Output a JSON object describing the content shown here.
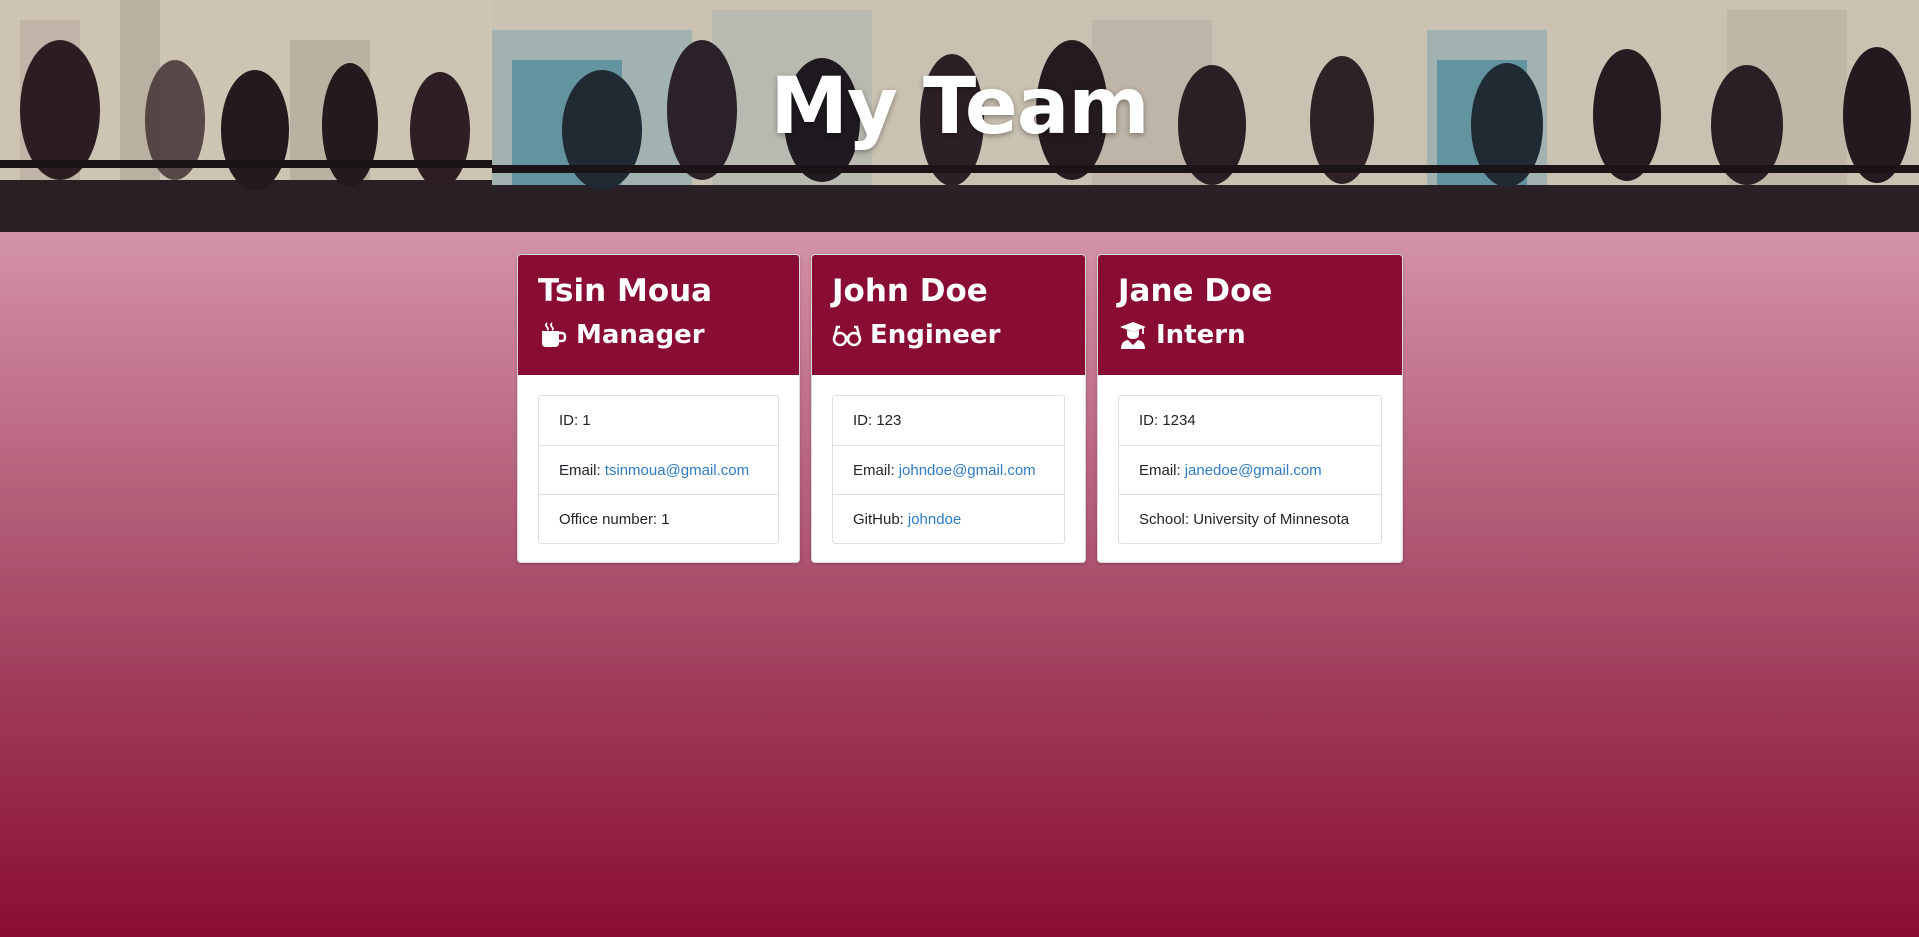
{
  "header": {
    "title": "My Team"
  },
  "team": [
    {
      "name": "Tsin Moua",
      "role": "Manager",
      "icon": "coffee-icon",
      "id_text": "ID: 1",
      "email_label": "Email:",
      "email": "tsinmoua@gmail.com",
      "extra_label": "Office number: 1",
      "extra_link": ""
    },
    {
      "name": "John Doe",
      "role": "Engineer",
      "icon": "glasses-icon",
      "id_text": "ID: 123",
      "email_label": "Email:",
      "email": "johndoe@gmail.com",
      "extra_label": "GitHub:",
      "extra_link": "johndoe"
    },
    {
      "name": "Jane Doe",
      "role": "Intern",
      "icon": "graduate-icon",
      "id_text": "ID: 1234",
      "email_label": "Email:",
      "email": "janedoe@gmail.com",
      "extra_label": "School: University of Minnesota",
      "extra_link": ""
    }
  ],
  "colors": {
    "card_header": "#890d32",
    "link": "#2f7bc4",
    "page_gradient_top": "#ebc6d2",
    "page_gradient_bottom": "#8a0d32"
  }
}
